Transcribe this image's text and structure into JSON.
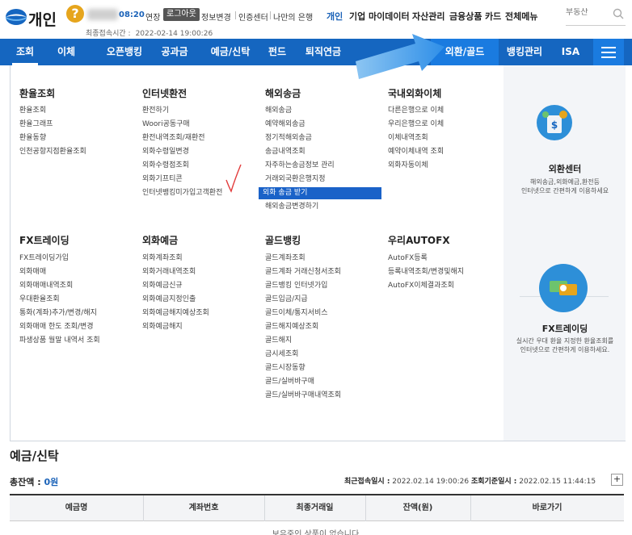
{
  "header": {
    "logo_text": "개인",
    "help_icon": "?",
    "session_timer": "08:20",
    "extend_label": "연장",
    "logout_label": "로그아웃",
    "links": [
      "정보변경",
      "인증센터",
      "나만의 은행"
    ],
    "last_access_label": "최종접속시간 :",
    "last_access_value": "2022-02-14 19:00:26",
    "gnav": [
      "개인",
      "기업",
      "마이데이터",
      "자산관리",
      "금융상품",
      "카드",
      "전체메뉴"
    ],
    "search_placeholder": "부동산"
  },
  "nav": {
    "items": [
      "조회",
      "이체",
      "오픈뱅킹",
      "공과금",
      "예금/신탁",
      "펀드",
      "퇴직연금",
      "외환/골드",
      "뱅킹관리",
      "ISA"
    ],
    "active": "조회",
    "highlighted": "외환/골드"
  },
  "megamenu": {
    "columns_row1": [
      {
        "title": "환율조회",
        "items": [
          "환율조회",
          "환율그래프",
          "환율동향",
          "인천공항지점환율조회"
        ]
      },
      {
        "title": "인터넷환전",
        "items": [
          "환전하기",
          "Woori공동구매",
          "환전내역조회/재환전",
          "외화수령일변경",
          "외화수령점조회",
          "외화기프티콘",
          "인터넷뱅킹미가입고객환전"
        ]
      },
      {
        "title": "해외송금",
        "items": [
          "해외송금",
          "예약해외송금",
          "정기적해외송금",
          "송금내역조회",
          "자주하는송금정보 관리",
          "거래외국환은행지정",
          "외화 송금 받기",
          "해외송금변경하기"
        ]
      },
      {
        "title": "국내외화이체",
        "items": [
          "다른은행으로 이체",
          "우리은행으로 이체",
          "이체내역조회",
          "예약이체내역 조회",
          "외화자동이체"
        ]
      }
    ],
    "columns_row2": [
      {
        "title": "FX트레이딩",
        "items": [
          "FX트레이딩가입",
          "외화매매",
          "외화매매내역조회",
          "우대환율조회",
          "통화(계좌)추가/변경/해지",
          "외화매매 한도 조회/변경",
          "파생상품 월말 내역서 조회"
        ]
      },
      {
        "title": "외화예금",
        "items": [
          "외화계좌조회",
          "외화거래내역조회",
          "외화예금신규",
          "외화예금지정인출",
          "외화예금해지예상조회",
          "외화예금해지"
        ]
      },
      {
        "title": "골드뱅킹",
        "items": [
          "골드계좌조회",
          "골드계좌 거래신청서조회",
          "골드뱅킹 인터넷가입",
          "골드입금/지급",
          "골드이체/통지서비스",
          "골드해지예상조회",
          "골드해지",
          "금시세조회",
          "골드시장동향",
          "골드/실버바구매",
          "골드/실버바구매내역조회"
        ]
      },
      {
        "title": "우리AUTOFX",
        "items": [
          "AutoFX등록",
          "등록내역조회/변경및해지",
          "AutoFX이체결과조회"
        ]
      }
    ],
    "highlighted_item": "외화 송금 받기",
    "promos": [
      {
        "title": "외환센터",
        "desc1": "해외송금,외화예금,환전등",
        "desc2": "인터넷으로 간편하게 이용하세요"
      },
      {
        "title": "FX트레이딩",
        "desc1": "실시간 우대 환율 지정한 환율조회를",
        "desc2": "인터넷으로 간편하게 이용하세요."
      }
    ]
  },
  "main": {
    "section_title": "예금/신탁",
    "total_label": "총잔액 :",
    "total_value": "0원",
    "last_access_label": "최근접속일시 :",
    "last_access_value": "2022.02.14 19:00:26",
    "base_date_label": "조회기준일시 :",
    "base_date_value": "2022.02.15 11:44:15",
    "plus": "+",
    "columns": [
      "예금명",
      "계좌번호",
      "최종거래일",
      "잔액(원)",
      "바로가기"
    ],
    "empty_message": "보유중인 상품이 없습니다."
  },
  "colors": {
    "primary": "#1566c0",
    "active_tab": "#1a7be0",
    "arrow": "#2f8fe8",
    "help": "#e6a51c"
  },
  "icons": [
    "logo-icon",
    "help-icon",
    "search-icon",
    "menu-icon",
    "arrow-icon",
    "checkmark-icon",
    "currency-icon",
    "exchange-icon"
  ]
}
